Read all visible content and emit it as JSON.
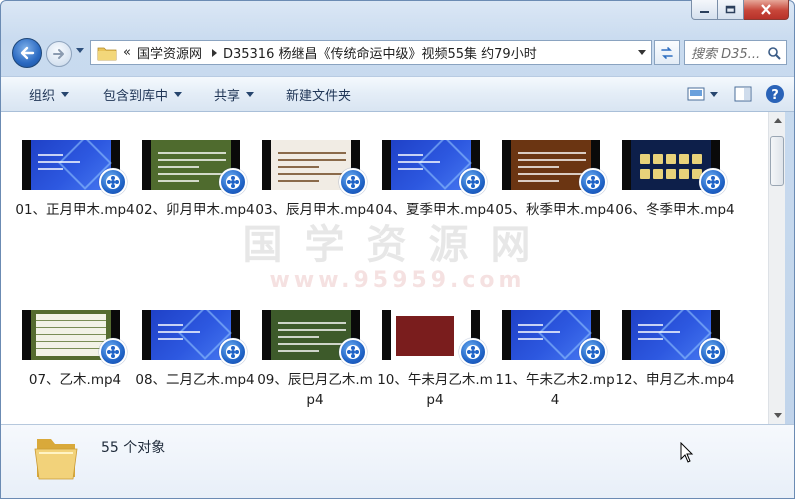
{
  "window": {
    "minimize_icon": "minimize-icon",
    "maximize_icon": "maximize-icon",
    "close_icon": "close-icon",
    "colors": {
      "frame": "#c9dbef",
      "close_button": "#c7463a",
      "accent": "#1f63c7"
    }
  },
  "nav": {
    "back_icon": "back-arrow-icon",
    "forward_icon": "forward-arrow-icon",
    "overflow": "«",
    "path": [
      "国学资源网",
      "D35316 杨继昌《传统命运中级》视频55集 约79小时"
    ],
    "refresh_icon": "refresh-icon",
    "search_placeholder": "搜索 D35..."
  },
  "toolbar": {
    "organize": "组织",
    "include_in_library": "包含到库中",
    "share": "共享",
    "new_folder": "新建文件夹",
    "view_icon": "view-options-icon",
    "preview_pane_icon": "preview-pane-icon",
    "help_icon": "help-icon"
  },
  "files": [
    {
      "name": "01、正月甲木.mp4",
      "theme": "blue"
    },
    {
      "name": "02、卯月甲木.mp4",
      "theme": "green"
    },
    {
      "name": "03、辰月甲木.mp4",
      "theme": "doc"
    },
    {
      "name": "04、夏季甲木.mp4",
      "theme": "blue"
    },
    {
      "name": "05、秋季甲木.mp4",
      "theme": "brown"
    },
    {
      "name": "06、冬季甲木.mp4",
      "theme": "navy"
    },
    {
      "name": "07、乙木.mp4",
      "theme": "table"
    },
    {
      "name": "08、二月乙木.mp4",
      "theme": "blue"
    },
    {
      "name": "09、辰巳月乙木.mp4",
      "theme": "green2"
    },
    {
      "name": "10、午未月乙木.mp4",
      "theme": "red"
    },
    {
      "name": "11、午未乙木2.mp4",
      "theme": "blue"
    },
    {
      "name": "12、申月乙木.mp4",
      "theme": "blue"
    }
  ],
  "watermark": {
    "main": "国学资源网",
    "sub": "www.95959.com"
  },
  "status": {
    "count": "55 个对象"
  }
}
